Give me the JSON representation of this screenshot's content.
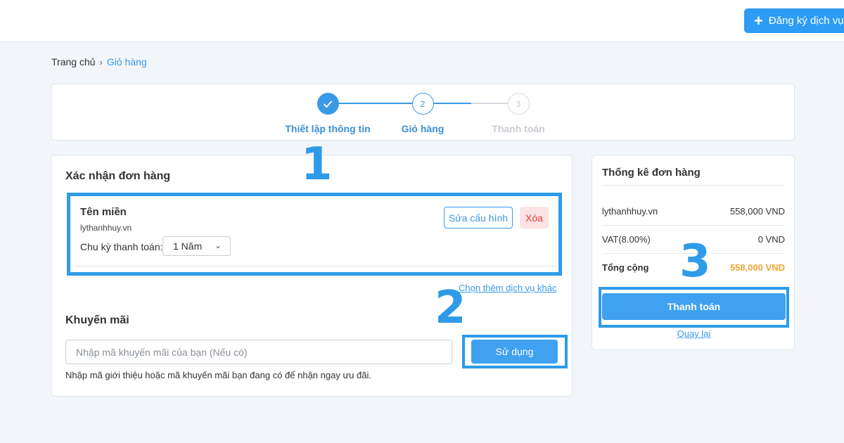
{
  "header": {
    "register_label": "Đăng ký dịch vụ"
  },
  "breadcrumb": {
    "home": "Trang chủ",
    "current": "Giỏ hàng"
  },
  "steps": [
    {
      "number": "",
      "label": "Thiết lập thông tin",
      "state": "done"
    },
    {
      "number": "2",
      "label": "Giỏ hàng",
      "state": "active"
    },
    {
      "number": "3",
      "label": "Thanh toán",
      "state": "pending"
    }
  ],
  "order": {
    "title": "Xác nhận đơn hàng",
    "item": {
      "name": "Tên miền",
      "domain": "lythanhhuy.vn",
      "cycle_label": "Chu kỳ thanh toán:",
      "cycle_value": "1 Năm",
      "edit_label": "Sửa cấu hình",
      "delete_label": "Xóa"
    },
    "more_link": "Chọn thêm dịch vụ khác"
  },
  "promo": {
    "title": "Khuyến mãi",
    "placeholder": "Nhập mã khuyến mãi của bạn (Nếu có)",
    "use_label": "Sử dụng",
    "help": "Nhập mã giới thiệu hoặc mã khuyến mãi bạn đang có để nhận ngay ưu đãi."
  },
  "summary": {
    "title": "Thống kê đơn hàng",
    "rows": [
      {
        "label": "lythanhhuy.vn",
        "value": "558,000 VND"
      },
      {
        "label": "VAT(8.00%)",
        "value": "0 VND"
      }
    ],
    "total": {
      "label": "Tổng cộng",
      "value": "558,000 VND"
    },
    "pay_label": "Thanh toán",
    "back_label": "Quay lại"
  },
  "markers": [
    "1",
    "2",
    "3"
  ],
  "colors": {
    "accent": "#2e9be8",
    "total": "#f0a433",
    "danger": "#e0393e"
  },
  "icons": {
    "done_step": "check-icon",
    "register": "plus-icon",
    "select": "chevron-down-icon",
    "breadcrumb_sep": "chevron-right-icon"
  }
}
